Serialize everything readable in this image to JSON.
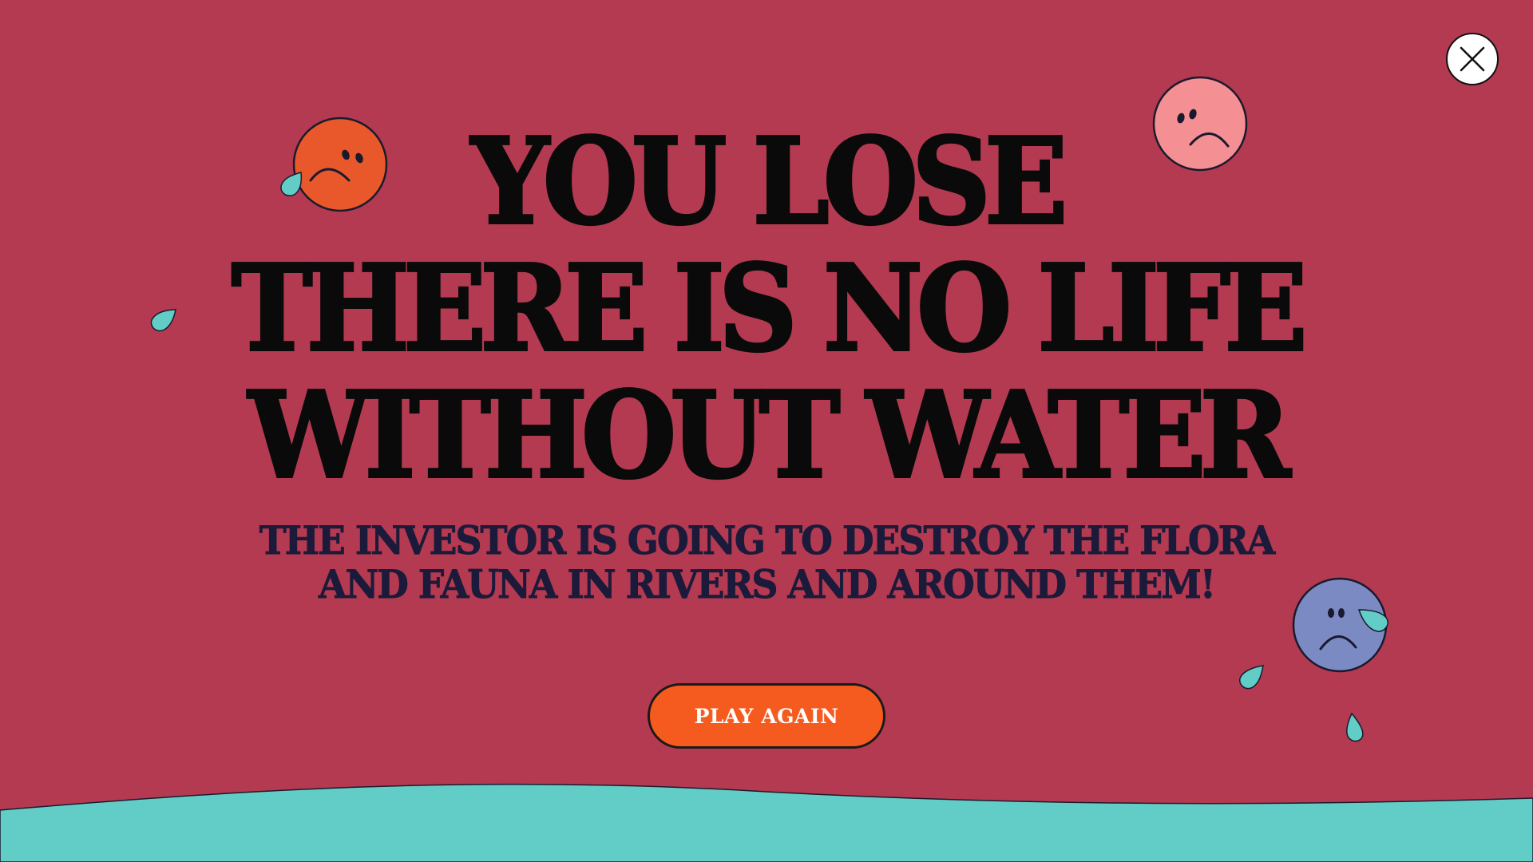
{
  "headline": {
    "line1": "YOU LOSE",
    "line2": "THERE IS NO LIFE",
    "line3": "WITHOUT WATER"
  },
  "subtitle": {
    "line1": "THE INVESTOR IS GOING TO DESTROY THE FLORA",
    "line2": "AND FAUNA IN RIVERS AND AROUND THEM!"
  },
  "play_again_button": {
    "label": "PLAY AGAIN"
  },
  "icons": {
    "close": "close-icon",
    "faces": [
      "sad-face-orange-icon",
      "sad-face-pink-icon",
      "sad-face-blue-icon"
    ],
    "drops": "water-drop-icon"
  },
  "colors": {
    "background": "#b33a50",
    "water": "#62cdc6",
    "button": "#f55a1e",
    "face_orange": "#e8582a",
    "face_pink": "#f49093",
    "face_blue": "#7c8ac4",
    "drop": "#62cdc6",
    "headline_text": "#0a0a0a",
    "subtitle_text": "#1c1a3a"
  }
}
